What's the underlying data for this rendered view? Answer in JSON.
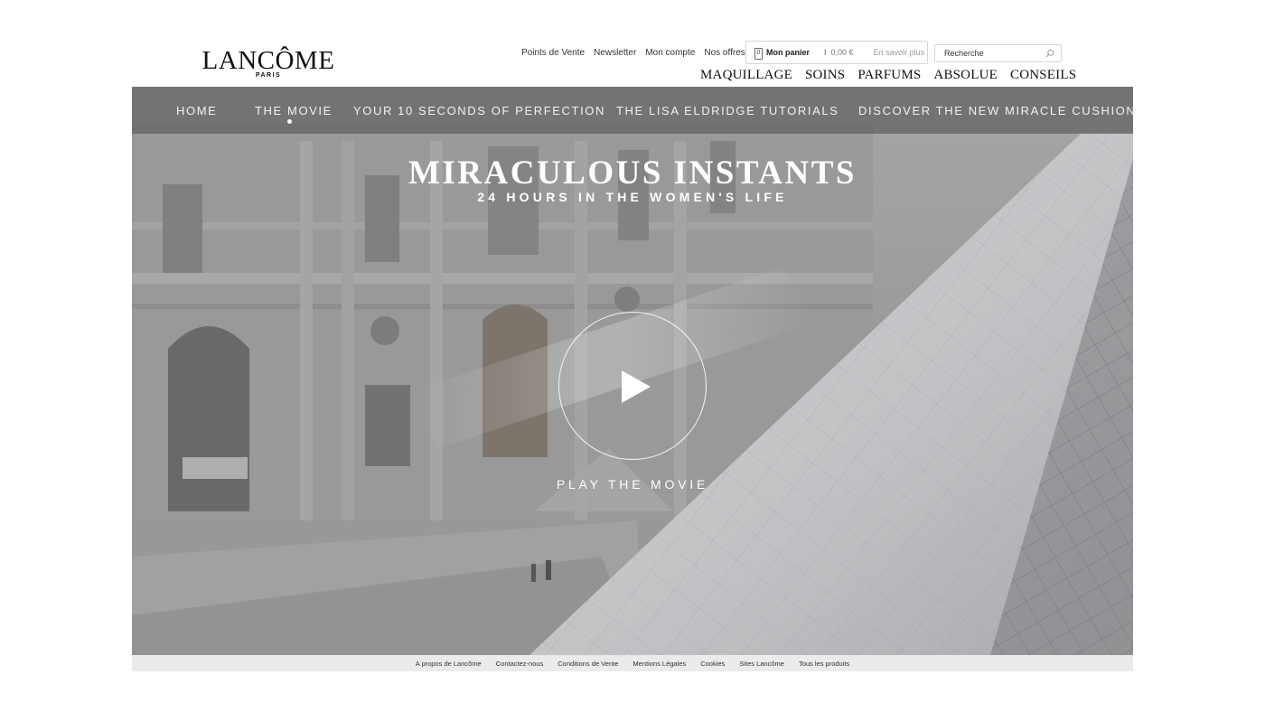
{
  "brand": {
    "name": "LANCÔME",
    "tagline": "PARIS"
  },
  "utility_links": [
    "Points de Vente",
    "Newsletter",
    "Mon compte",
    "Nos offres"
  ],
  "cart": {
    "count": "0",
    "label": "Mon panier",
    "separator": "I",
    "amount": "0,00 €",
    "more": "En savoir plus"
  },
  "search": {
    "placeholder": "Recherche",
    "icon": "magnifier-icon"
  },
  "main_nav": [
    "MAQUILLAGE",
    "SOINS",
    "PARFUMS",
    "ABSOLUE",
    "CONSEILS"
  ],
  "sub_nav": {
    "items": [
      "HOME",
      "THE MOVIE",
      "YOUR 10 SECONDS OF PERFECTION",
      "THE LISA ELDRIDGE TUTORIALS",
      "DISCOVER THE NEW MIRACLE CUSHION"
    ],
    "active": "THE MOVIE"
  },
  "hero": {
    "title": "MIRACULOUS INSTANTS",
    "subtitle": "24 HOURS IN THE WOMEN'S LIFE",
    "play_label": "PLAY THE MOVIE",
    "play_icon": "play-icon"
  },
  "footer_links": [
    "A propos de Lancôme",
    "Contactez-nous",
    "Conditions de Vente",
    "Mentions Légales",
    "Cookies",
    "Sites Lancôme",
    "Tous les produits"
  ]
}
